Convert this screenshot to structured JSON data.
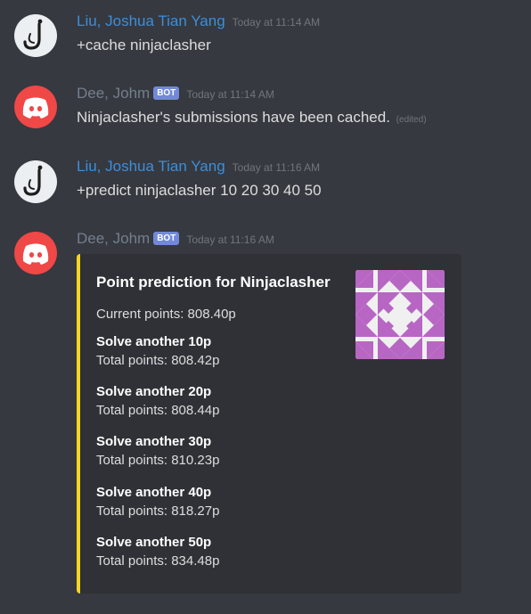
{
  "messages": [
    {
      "username": "Liu, Joshua Tian Yang",
      "timestamp": "Today at 11:14 AM",
      "content": "+cache ninjaclasher"
    },
    {
      "username": "Dee, Johm",
      "bot_tag": "BOT",
      "timestamp": "Today at 11:14 AM",
      "content": "Ninjaclasher's submissions have been cached.",
      "edited": "(edited)"
    },
    {
      "username": "Liu, Joshua Tian Yang",
      "timestamp": "Today at 11:16 AM",
      "content": "+predict ninjaclasher 10 20 30 40 50"
    },
    {
      "username": "Dee, Johm",
      "bot_tag": "BOT",
      "timestamp": "Today at 11:16 AM",
      "embed": {
        "accent_color": "#f9d423",
        "title": "Point prediction for Ninjaclasher",
        "description": "Current points: 808.40p",
        "thumbnail_icon": "identicon-avatar",
        "fields": [
          {
            "name": "Solve another 10p",
            "value": "Total points: 808.42p"
          },
          {
            "name": "Solve another 20p",
            "value": "Total points: 808.44p"
          },
          {
            "name": "Solve another 30p",
            "value": "Total points: 810.23p"
          },
          {
            "name": "Solve another 40p",
            "value": "Total points: 818.27p"
          },
          {
            "name": "Solve another 50p",
            "value": "Total points: 834.48p"
          }
        ]
      }
    }
  ],
  "colors": {
    "background": "#36393f",
    "embed_background": "#2f3136",
    "user_name": "#3c8edb",
    "bot_name": "#747f8d",
    "bot_tag": "#7289da",
    "bot_avatar": "#f04747"
  }
}
